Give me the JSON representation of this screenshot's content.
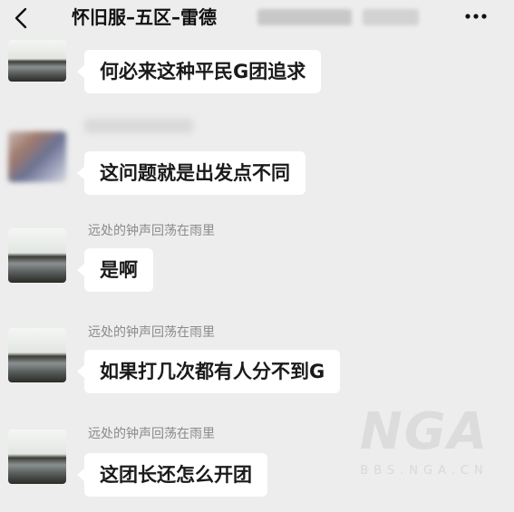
{
  "header": {
    "title": "怀旧服–五区–雷德",
    "back_icon": "chevron-left-icon",
    "more_icon": "more-dots-icon"
  },
  "messages": [
    {
      "sender": "",
      "text": "何必来这种平民G团追求"
    },
    {
      "sender": "",
      "text": "这问题就是出发点不同"
    },
    {
      "sender": "远处的钟声回荡在雨里",
      "text": "是啊"
    },
    {
      "sender": "远处的钟声回荡在雨里",
      "text": "如果打几次都有人分不到G"
    },
    {
      "sender": "远处的钟声回荡在雨里",
      "text": "这团长还怎么开团"
    }
  ],
  "watermark": {
    "logo": "NGA",
    "sub": "BBS.NGA.CN"
  }
}
